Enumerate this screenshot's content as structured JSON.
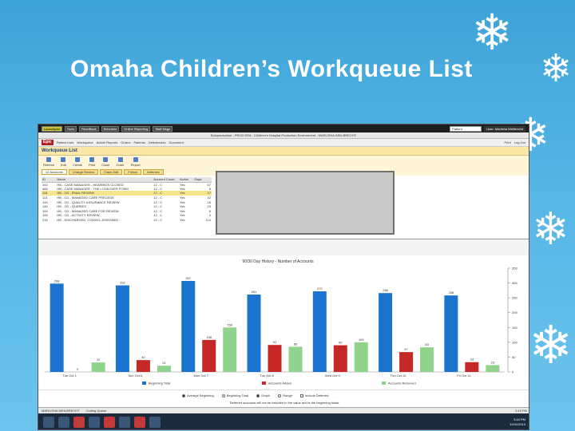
{
  "slide": {
    "title": "Omaha Children’s Workqueue List"
  },
  "topbar": {
    "buttons": [
      "Launchpad",
      "Tools",
      "ReadBack",
      "Schedule",
      "Online Reporting",
      "Staff Msgs"
    ],
    "search_placeholder": "Patient",
    "user": "User: Marlisha Weilbrecht"
  },
  "titlebar": {
    "text": "Epicproduction - PROD ERA - Children's Hospital Production Environment - MARLISHA WEILBRECHT"
  },
  "menubar": {
    "epic": "Epic",
    "items": [
      "Patient Lists",
      "Workqueue",
      "Admin Reports",
      "Orders",
      "Patients",
      "Deficiencies",
      "Document"
    ],
    "right": [
      "Print",
      "Log Out"
    ]
  },
  "workqueue": {
    "title": "Workqueue List",
    "tools": [
      "Refresh",
      "Edit",
      "Create",
      "Print",
      "Close",
      "Order",
      "Report"
    ],
    "tabs": [
      {
        "label": "12 Accounts",
        "active": true
      },
      {
        "label": "Charge Review",
        "active": false
      },
      {
        "label": "Claim Edit",
        "active": false
      },
      {
        "label": "Follow",
        "active": false
      },
      {
        "label": "Deferred",
        "active": false
      }
    ],
    "columns": [
      "ID",
      "Name",
      "Account Count",
      "Active",
      "Days"
    ],
    "rows": [
      {
        "id": "192",
        "name": "HB - CASE MANAGER - HEARINGS CLOSED",
        "count": "12 - C",
        "active": "Yes",
        "days": "67",
        "selected": false
      },
      {
        "id": "466",
        "name": "HB - CASE MANAGER - THE LOOKOVER FORM",
        "count": "12 - C",
        "active": "Yes",
        "days": "6",
        "selected": false
      },
      {
        "id": "116",
        "name": "HB - CD - FINAL REVIEW",
        "count": "12 - C",
        "active": "Yes",
        "days": "27",
        "selected": true
      },
      {
        "id": "113",
        "name": "HB - CD - MANAGED CARE PRECEDE",
        "count": "12 - C",
        "active": "Yes",
        "days": "42",
        "selected": false
      },
      {
        "id": "144",
        "name": "HB - CD - QUALITY ASSURANCE REVIEW",
        "count": "12 - C",
        "active": "Yes",
        "days": "18",
        "selected": false
      },
      {
        "id": "145",
        "name": "HB - CD - QUERIES",
        "count": "12 - C",
        "active": "Yes",
        "days": "23",
        "selected": false
      },
      {
        "id": "194",
        "name": "HB - CD - MANAGED CARE FOR REVIEW",
        "count": "12 - C",
        "active": "Yes",
        "days": "6",
        "selected": false
      },
      {
        "id": "195",
        "name": "HB - CD - ACTIVITY REVIEW",
        "count": "12 - C",
        "active": "Yes",
        "days": "4",
        "selected": false
      },
      {
        "id": "216",
        "name": "HB - DISCHARGED, CODING, ASSIGNED",
        "count": "12 - C",
        "active": "Yes",
        "days": "114",
        "selected": false
      }
    ]
  },
  "chart_data": {
    "type": "bar",
    "title": "90/30 Day History - Number of Accounts",
    "categories": [
      "Tue Oct 1",
      "Sun Oct 6",
      "Mon Oct 7",
      "Tue Oct 8",
      "Wed Oct 9",
      "Thu Oct 10",
      "Fri Oct 11"
    ],
    "series": [
      {
        "name": "Beginning Total",
        "color": "#1a74d0",
        "values": [
          298,
          292,
          307,
          261,
          272,
          266,
          258
        ]
      },
      {
        "name": "Accounts Added",
        "color": "#c62828",
        "values": [
          0,
          40,
          108,
          91,
          90,
          67,
          33
        ]
      },
      {
        "name": "Accounts Removed",
        "color": "#8fd38c",
        "values": [
          32,
          21,
          150,
          85,
          100,
          83,
          23
        ]
      }
    ],
    "ylim": [
      0,
      350
    ],
    "yticks": [
      0,
      50,
      100,
      150,
      200,
      250,
      300,
      350
    ],
    "ytick_labels": [
      "0",
      "50",
      "100",
      "150",
      "200",
      "250",
      "300",
      "350"
    ],
    "grid": false,
    "legend": "bottom"
  },
  "radios": [
    {
      "label": "Average Beginning",
      "on": true
    },
    {
      "label": "Beginning Total",
      "on": false
    },
    {
      "label": "Graph",
      "on": true
    },
    {
      "label": "Range",
      "on": false
    },
    {
      "label": "Include Deferred",
      "on": false
    }
  ],
  "footnote": "Deferred accounts will not be included in the value and is the beginning totals",
  "status_bar": {
    "user": "MARLISHA WEILBRECHT",
    "status": "Coding Queue",
    "time": "3:16 PM"
  },
  "taskbar": {
    "clock_time": "3:16 PM",
    "clock_date": "10/11/2013"
  },
  "colors": {
    "background": "#3ea3d8",
    "accent": "#fbe8a9"
  }
}
